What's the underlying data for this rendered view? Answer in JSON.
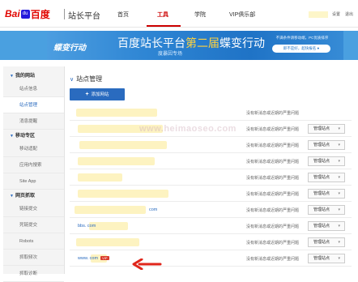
{
  "header": {
    "logo_bai": "Bai",
    "logo_paw": "du",
    "logo_du": "百度",
    "site_title": "站长平台",
    "nav": [
      "首页",
      "工具",
      "学院",
      "VIP俱乐部"
    ],
    "links": [
      "设置",
      "退出"
    ]
  },
  "banner": {
    "script_logo": "蝶变行动",
    "title_prefix": "百度站长平台",
    "title_highlight": "第二届",
    "title_suffix": "蝶变行动",
    "subtitle": "度暴因专场",
    "note": "不满条件请移动端，PC优质排序",
    "button": "即不是好，超快报名 ●"
  },
  "sidebar": {
    "sections": [
      {
        "title": "我的网站",
        "items": [
          "站点信息",
          "站点管理",
          "消息提醒"
        ]
      },
      {
        "title": "移动专区",
        "items": [
          "移动适配",
          "应用内搜索",
          "Site App"
        ]
      },
      {
        "title": "网页抓取",
        "items": [
          "链接提交",
          "死链提交",
          "Robots",
          "抓取频次",
          "抓取诊断"
        ]
      }
    ],
    "active_item": "站点管理"
  },
  "main": {
    "title": "站点管理",
    "add_button": "添加网站",
    "watermark": "www.heimaoseo.com",
    "manage_label": "管理站点",
    "rows": [
      {
        "domain": "",
        "status": "没有新消息或近期的严重问题"
      },
      {
        "domain": "",
        "status": "没有新消息或近期的严重问题"
      },
      {
        "domain": "",
        "status": "没有新消息或近期的严重问题"
      },
      {
        "domain": "",
        "status": "没有新消息或近期的严重问题"
      },
      {
        "domain": "",
        "status": "没有新消息或近期的严重问题"
      },
      {
        "domain": "",
        "status": "没有新消息或近期的严重问题"
      },
      {
        "domain": "com",
        "status": "没有新消息或近期的严重问题"
      },
      {
        "domain": "bbs.                com",
        "status": "没有新消息或近期的严重问题"
      },
      {
        "domain": "",
        "status": "没有新消息或近期的严重问题"
      },
      {
        "domain": "www.        com",
        "status": "没有新消息或近期的严重问题",
        "vip": "VIP"
      }
    ]
  },
  "colors": {
    "brand_red": "#e10601",
    "accent_blue": "#2a6bbf",
    "nav_active": "#cc0000",
    "arrow_red": "#e0261b"
  }
}
